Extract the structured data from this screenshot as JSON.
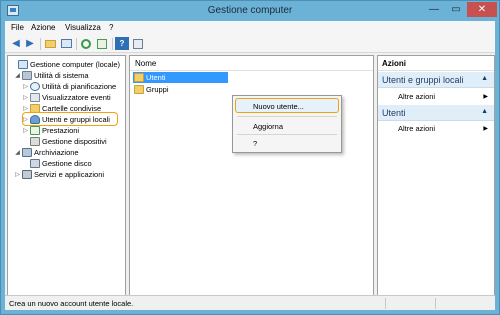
{
  "window": {
    "title": "Gestione computer",
    "btn_min": "—",
    "btn_max": "▭",
    "btn_close": "✕"
  },
  "menu": {
    "items": [
      "File",
      "Azione",
      "Visualizza",
      "?"
    ]
  },
  "toolbar": {
    "back": "◀",
    "forward": "▶",
    "help": "?"
  },
  "tree": {
    "items": [
      {
        "label": "Gestione computer (locale)",
        "icon": "computer-icon"
      },
      {
        "label": "Utilità di sistema",
        "icon": "tools-icon"
      },
      {
        "label": "Utilità di pianificazione",
        "icon": "clock-icon"
      },
      {
        "label": "Visualizzatore eventi",
        "icon": "events-icon"
      },
      {
        "label": "Cartelle condivise",
        "icon": "folder-icon"
      },
      {
        "label": "Utenti e gruppi locali",
        "icon": "users-icon"
      },
      {
        "label": "Prestazioni",
        "icon": "performance-icon"
      },
      {
        "label": "Gestione dispositivi",
        "icon": "device-icon"
      },
      {
        "label": "Archiviazione",
        "icon": "storage-icon"
      },
      {
        "label": "Gestione disco",
        "icon": "disk-icon"
      },
      {
        "label": "Servizi e applicazioni",
        "icon": "services-icon"
      }
    ]
  },
  "list": {
    "header": "Nome",
    "rows": [
      {
        "label": "Utenti"
      },
      {
        "label": "Gruppi"
      }
    ]
  },
  "context_menu": {
    "items": [
      "Nuovo utente...",
      "Aggiorna",
      "?"
    ]
  },
  "actions": {
    "header": "Azioni",
    "sections": [
      {
        "title": "Utenti e gruppi locali",
        "item": "Altre azioni"
      },
      {
        "title": "Utenti",
        "item": "Altre azioni"
      }
    ]
  },
  "status": {
    "text": "Crea un nuovo account utente locale."
  },
  "colors": {
    "titlebar": "#6cb1d6",
    "selection": "#3399ff",
    "highlight": "#f0a30a",
    "close": "#c75050"
  }
}
